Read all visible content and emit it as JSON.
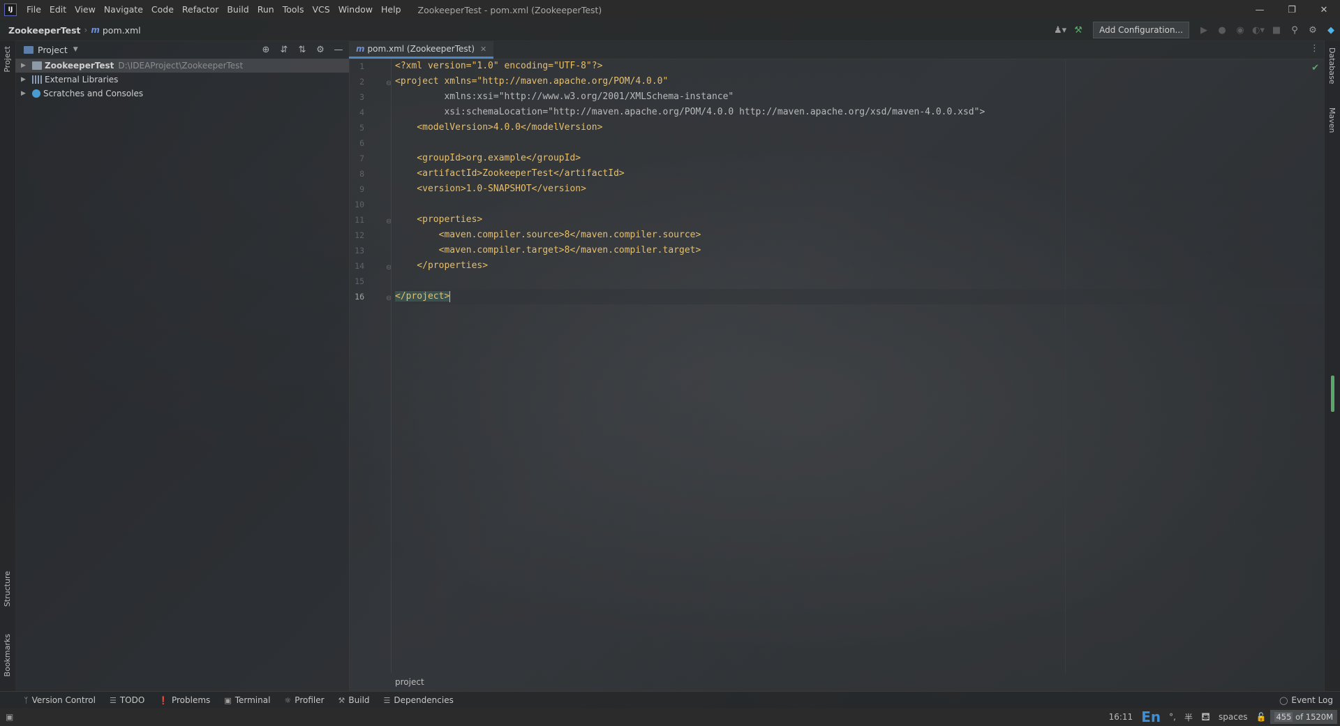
{
  "menu": {
    "logo_text": "IJ",
    "items": [
      "File",
      "Edit",
      "View",
      "Navigate",
      "Code",
      "Refactor",
      "Build",
      "Run",
      "Tools",
      "VCS",
      "Window",
      "Help"
    ],
    "window_title": "ZookeeperTest - pom.xml (ZookeeperTest)"
  },
  "window_controls": {
    "minimize": "—",
    "restore": "❐",
    "close": "✕"
  },
  "nav": {
    "project": "ZookeeperTest",
    "file_icon": "m",
    "file": "pom.xml",
    "add_configuration": "Add Configuration..."
  },
  "project_panel": {
    "title": "Project",
    "tree": [
      {
        "label": "ZookeeperTest",
        "path": "D:\\IDEAProject\\ZookeeperTest",
        "selected": true,
        "icon": "folder-icon"
      },
      {
        "label": "External Libraries",
        "path": "",
        "selected": false,
        "icon": "library-icon"
      },
      {
        "label": "Scratches and Consoles",
        "path": "",
        "selected": false,
        "icon": "scratch-icon"
      }
    ]
  },
  "editor": {
    "tab_label": "pom.xml (ZookeeperTest)",
    "breadcrumb": "project",
    "line_numbers": [
      "1",
      "2",
      "3",
      "4",
      "5",
      "6",
      "7",
      "8",
      "9",
      "10",
      "11",
      "12",
      "13",
      "14",
      "15",
      "16"
    ],
    "current_line": "16",
    "lines": [
      {
        "n": "1",
        "text": "<?xml version=\"1.0\" encoding=\"UTF-8\"?>"
      },
      {
        "n": "2",
        "text": "<project xmlns=\"http://maven.apache.org/POM/4.0.0\""
      },
      {
        "n": "3",
        "text": "         xmlns:xsi=\"http://www.w3.org/2001/XMLSchema-instance\""
      },
      {
        "n": "4",
        "text": "         xsi:schemaLocation=\"http://maven.apache.org/POM/4.0.0 http://maven.apache.org/xsd/maven-4.0.0.xsd\">"
      },
      {
        "n": "5",
        "text": "    <modelVersion>4.0.0</modelVersion>"
      },
      {
        "n": "6",
        "text": ""
      },
      {
        "n": "7",
        "text": "    <groupId>org.example</groupId>"
      },
      {
        "n": "8",
        "text": "    <artifactId>ZookeeperTest</artifactId>"
      },
      {
        "n": "9",
        "text": "    <version>1.0-SNAPSHOT</version>"
      },
      {
        "n": "10",
        "text": ""
      },
      {
        "n": "11",
        "text": "    <properties>"
      },
      {
        "n": "12",
        "text": "        <maven.compiler.source>8</maven.compiler.source>"
      },
      {
        "n": "13",
        "text": "        <maven.compiler.target>8</maven.compiler.target>"
      },
      {
        "n": "14",
        "text": "    </properties>"
      },
      {
        "n": "15",
        "text": ""
      },
      {
        "n": "16",
        "text": "</project>"
      }
    ]
  },
  "left_stripe": {
    "project": "Project",
    "structure": "Structure",
    "bookmarks": "Bookmarks"
  },
  "right_stripe": {
    "database": "Database",
    "maven": "Maven"
  },
  "tool_windows": [
    {
      "label": "Version Control",
      "icon": "branch-icon"
    },
    {
      "label": "TODO",
      "icon": "list-icon"
    },
    {
      "label": "Problems",
      "icon": "problems-icon"
    },
    {
      "label": "Terminal",
      "icon": "terminal-icon"
    },
    {
      "label": "Profiler",
      "icon": "profiler-icon"
    },
    {
      "label": "Build",
      "icon": "hammer-icon"
    },
    {
      "label": "Dependencies",
      "icon": "dependencies-icon"
    }
  ],
  "event_log": "Event Log",
  "status": {
    "position": "16:11",
    "ime": "En",
    "ime_punct": "°,",
    "ime_width": "半",
    "indent": "spaces",
    "memory_used": "455",
    "memory_total": "of 1520M"
  }
}
